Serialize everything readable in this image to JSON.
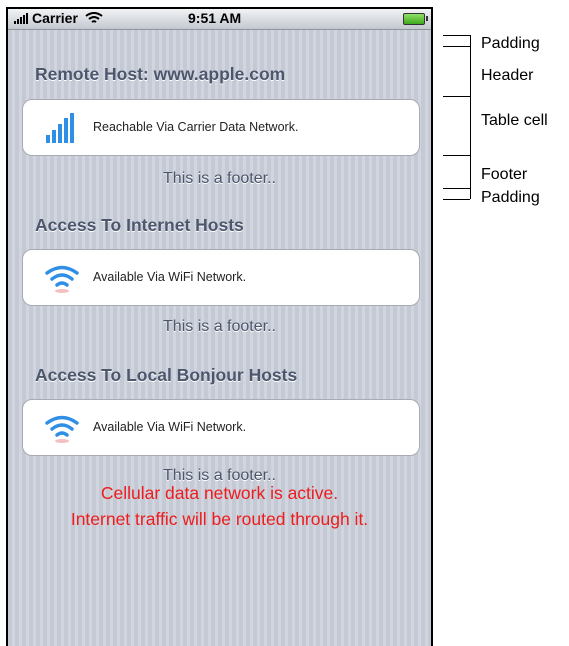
{
  "statusbar": {
    "carrier": "Carrier",
    "time": "9:51 AM"
  },
  "sections": [
    {
      "header": "Remote Host: www.apple.com",
      "cell_label": "Reachable Via Carrier Data Network.",
      "cell_icon": "cellular-bars-icon",
      "footer": "This is a footer.."
    },
    {
      "header": "Access To Internet Hosts",
      "cell_label": "Available Via WiFi Network.",
      "cell_icon": "wifi-icon",
      "footer": "This is a footer.."
    },
    {
      "header": "Access To Local Bonjour Hosts",
      "cell_label": "Available Via WiFi Network.",
      "cell_icon": "wifi-icon",
      "footer": "This is a footer.."
    }
  ],
  "alert": {
    "line1": "Cellular data network is active.",
    "line2": "Internet traffic will be routed through it."
  },
  "annotations": {
    "padding_top": "Padding",
    "header": "Header",
    "table_cell": "Table cell",
    "footer": "Footer",
    "padding_bottom": "Padding"
  },
  "colors": {
    "header_text": "#4c566c",
    "alert_text": "#ee1c1c",
    "cell_icon": "#2f8fe6"
  }
}
